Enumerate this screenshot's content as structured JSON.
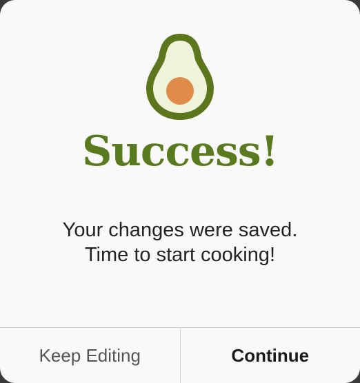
{
  "dialog": {
    "icon": "avocado-icon",
    "title": "Success!",
    "message_line1": "Your changes were saved.",
    "message_line2": "Time to start cooking!",
    "actions": {
      "secondary_label": "Keep Editing",
      "primary_label": "Continue"
    }
  },
  "colors": {
    "title": "#5a7a1f",
    "avocado_skin": "#5b761c",
    "avocado_flesh": "#eef3da",
    "avocado_pit": "#df8c4a"
  }
}
